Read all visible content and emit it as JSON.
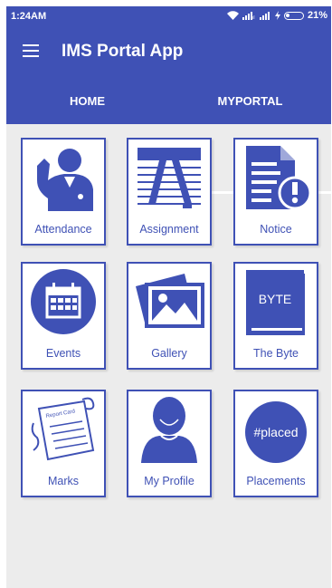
{
  "status_bar": {
    "time": "1:24AM",
    "battery": "21%"
  },
  "app_bar": {
    "title": "IMS Portal App",
    "menu_icon": "hamburger-menu-icon"
  },
  "tabs": [
    {
      "label": "HOME",
      "selected": false
    },
    {
      "label": "MYPORTAL",
      "selected": true
    }
  ],
  "tiles": [
    {
      "label": "Attendance",
      "icon": "attendance-icon"
    },
    {
      "label": "Assignment",
      "icon": "assignment-icon"
    },
    {
      "label": "Notice",
      "icon": "notice-icon"
    },
    {
      "label": "Events",
      "icon": "events-calendar-icon"
    },
    {
      "label": "Gallery",
      "icon": "gallery-icon"
    },
    {
      "label": "The Byte",
      "icon": "the-byte-book-icon",
      "icon_text": "BYTE"
    },
    {
      "label": "Marks",
      "icon": "marks-report-card-icon",
      "icon_text": "Report Card"
    },
    {
      "label": "My Profile",
      "icon": "profile-person-icon"
    },
    {
      "label": "Placements",
      "icon": "placements-icon",
      "icon_text": "#placed"
    }
  ],
  "colors": {
    "primary": "#3f51b5",
    "background": "#ececec",
    "tile": "#ffffff"
  }
}
